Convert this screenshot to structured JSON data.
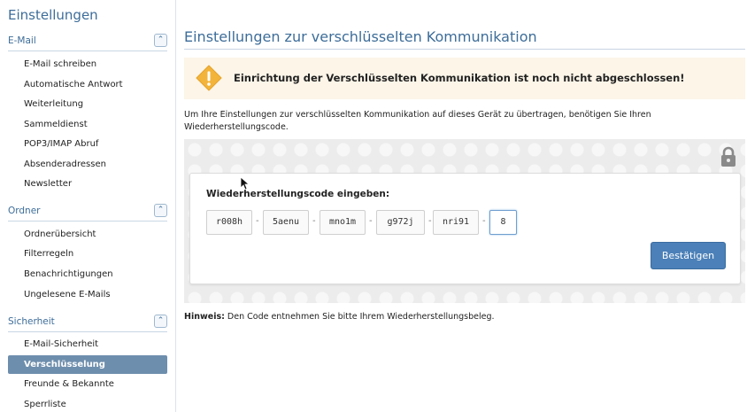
{
  "sidebar": {
    "title": "Einstellungen",
    "sections": [
      {
        "label": "E-Mail",
        "items": [
          "E-Mail schreiben",
          "Automatische Antwort",
          "Weiterleitung",
          "Sammeldienst",
          "POP3/IMAP Abruf",
          "Absenderadressen",
          "Newsletter"
        ]
      },
      {
        "label": "Ordner",
        "items": [
          "Ordnerübersicht",
          "Filterregeln",
          "Benachrichtigungen",
          "Ungelesene E-Mails"
        ]
      },
      {
        "label": "Sicherheit",
        "items": [
          "E-Mail-Sicherheit",
          "Verschlüsselung",
          "Freunde & Bekannte",
          "Sperrliste"
        ]
      }
    ],
    "active_item": "Verschlüsselung",
    "collapse_icon": "double-chevron-up-icon"
  },
  "main": {
    "title": "Einstellungen zur verschlüsselten Kommunikation",
    "alert": {
      "icon": "warning-icon",
      "text": "Einrichtung der Verschlüsselten Kommunikation ist noch nicht abgeschlossen!",
      "color": "#f2b43a"
    },
    "intro": "Um Ihre Einstellungen zur verschlüsselten Kommunikation auf dieses Gerät zu übertragen, benötigen Sie Ihren Wiederherstellungscode.",
    "lock_icon": "padlock-icon",
    "recovery": {
      "label": "Wiederherstellungscode eingeben:",
      "fields": [
        "r008h",
        "5aenu",
        "mno1m",
        "g972j",
        "nri91",
        "8"
      ],
      "separator": "-",
      "confirm_label": "Bestätigen"
    },
    "hint_label": "Hinweis:",
    "hint_text": " Den Code entnehmen Sie bitte Ihrem Wiederherstellungsbeleg."
  },
  "colors": {
    "accent": "#3d6d99",
    "button": "#4b80b8",
    "active_nav": "#6e8ead",
    "alert_bg": "#fcf5e8"
  }
}
